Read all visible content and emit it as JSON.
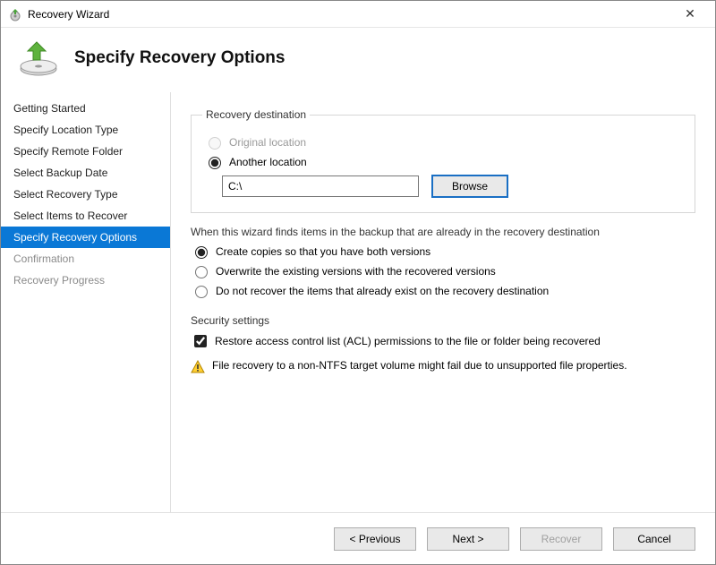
{
  "window": {
    "title": "Recovery Wizard"
  },
  "header": {
    "title": "Specify Recovery Options"
  },
  "sidebar": {
    "steps": [
      "Getting Started",
      "Specify Location Type",
      "Specify Remote Folder",
      "Select Backup Date",
      "Select Recovery Type",
      "Select Items to Recover",
      "Specify Recovery Options",
      "Confirmation",
      "Recovery Progress"
    ],
    "selected_index": 6
  },
  "destination": {
    "legend": "Recovery destination",
    "original_label": "Original location",
    "another_label": "Another location",
    "selected": "another",
    "original_disabled": true,
    "path_value": "C:\\",
    "browse_label": "Browse"
  },
  "conflict": {
    "legend": "When this wizard finds items in the backup that are already in the recovery destination",
    "options": [
      "Create copies so that you have both versions",
      "Overwrite the existing versions with the recovered versions",
      "Do not recover the items that already exist on the recovery destination"
    ],
    "selected_index": 0
  },
  "security": {
    "legend": "Security settings",
    "acl_label": "Restore access control list (ACL) permissions to the file or folder being recovered",
    "acl_checked": true
  },
  "warning": {
    "text": "File recovery to a non-NTFS target volume might fail due to unsupported file properties."
  },
  "footer": {
    "previous": "< Previous",
    "next": "Next >",
    "recover": "Recover",
    "cancel": "Cancel",
    "recover_disabled": true
  }
}
